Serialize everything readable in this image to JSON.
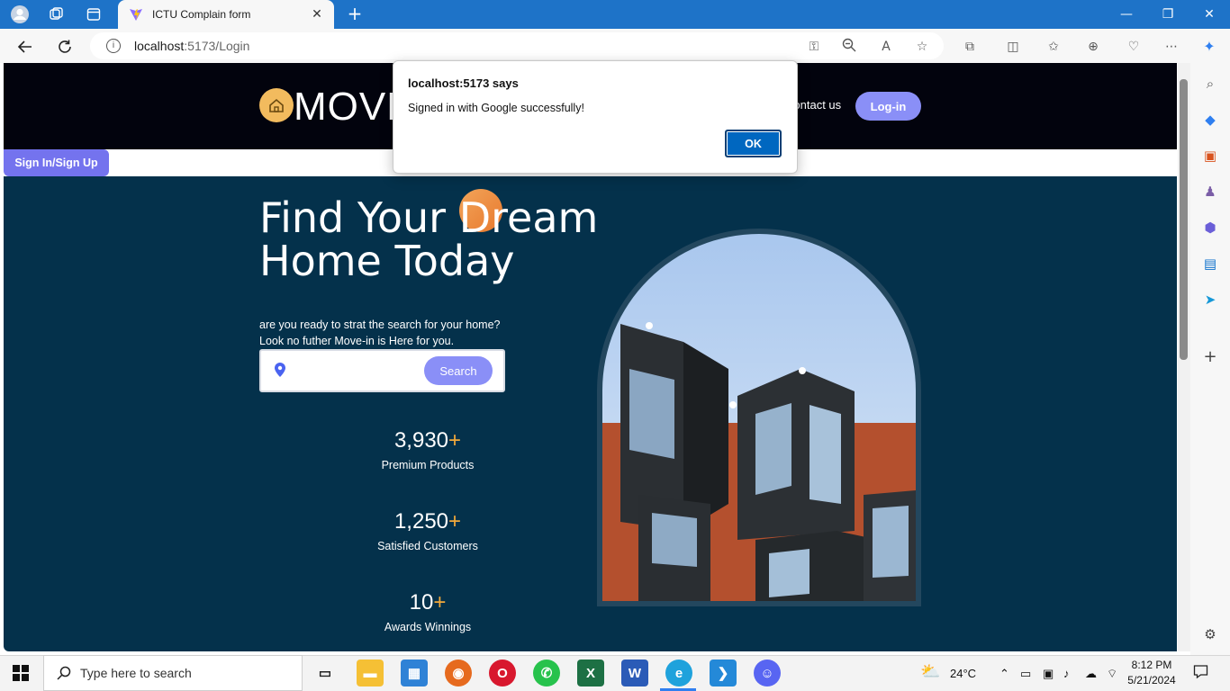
{
  "browser": {
    "tab_title": "ICTU Complain form",
    "tab_close": "✕",
    "new_tab": "+",
    "url_host": "localhost",
    "url_rest": ":5173/Login",
    "window_controls": [
      "—",
      "❐",
      "✕"
    ]
  },
  "site": {
    "logo_text": "MOVE-IN",
    "nav_contact": "Contact us",
    "login_label": "Log-in",
    "signin_label": "Sign In/Sign Up",
    "hero_title_line1": "Find Your Dream",
    "hero_title_line2": "Home Today",
    "hero_sub_line1": "are you ready to strat the search for your home?",
    "hero_sub_line2": "Look no futher Move-in is Here for you.",
    "search_placeholder": "",
    "search_button": "Search",
    "stats": [
      {
        "value": "3,930",
        "plus": "+",
        "label": "Premium Products"
      },
      {
        "value": "1,250",
        "plus": "+",
        "label": "Satisfied Customers"
      },
      {
        "value": "10",
        "plus": "+",
        "label": "Awards Winnings"
      }
    ]
  },
  "dialog": {
    "title": "localhost:5173 says",
    "message": "Signed in with Google successfully!",
    "ok_label": "OK"
  },
  "taskbar": {
    "search_placeholder": "Type here to search",
    "weather": "24°C",
    "time": "8:12 PM",
    "date": "5/21/2024"
  },
  "colors": {
    "header_bg": "#02030d",
    "hero_bg": "#04314b",
    "accent_purple": "#8a8ff7",
    "accent_orange": "#f2a93b",
    "edge_blue": "#1e73c8"
  }
}
